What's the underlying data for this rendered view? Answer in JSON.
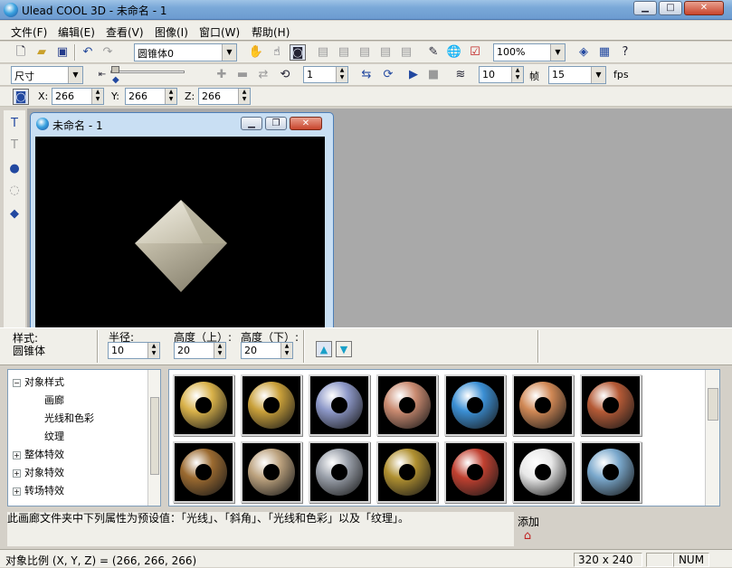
{
  "window": {
    "title": "Ulead COOL 3D - 未命名 - 1"
  },
  "menu": [
    "文件(F)",
    "编辑(E)",
    "查看(V)",
    "图像(I)",
    "窗口(W)",
    "帮助(H)"
  ],
  "toolbar1": {
    "object_select": "圆锥体0",
    "zoom": "100%"
  },
  "toolbar2": {
    "attr_select": "尺寸",
    "frame_value": "1",
    "frames_value": "10",
    "frames_label": "帧",
    "fps_value": "15",
    "fps_label": "fps"
  },
  "toolbar3": {
    "x_label": "X:",
    "x_value": "266",
    "y_label": "Y:",
    "y_value": "266",
    "z_label": "Z:",
    "z_value": "266"
  },
  "doc": {
    "title": "未命名 - 1"
  },
  "props": {
    "style_label": "样式:",
    "style_value": "圆锥体",
    "radius_label": "半径:",
    "radius_value": "10",
    "height_top_label": "高度（上）:",
    "height_top_value": "20",
    "height_bottom_label": "高度（下）:",
    "height_bottom_value": "20"
  },
  "tree": {
    "items": [
      {
        "label": "对象样式",
        "expander": "−"
      },
      {
        "label": "画廊"
      },
      {
        "label": "光线和色彩"
      },
      {
        "label": "纹理"
      },
      {
        "label": "整体特效",
        "expander": "+"
      },
      {
        "label": "对象特效",
        "expander": "+"
      },
      {
        "label": "转场特效",
        "expander": "+"
      }
    ]
  },
  "gallery": {
    "presets": [
      {
        "color": "#d9b24a"
      },
      {
        "color": "#c9a03a"
      },
      {
        "color": "#8d98c8"
      },
      {
        "color": "#c98a70"
      },
      {
        "color": "#3b8fd4"
      },
      {
        "color": "#d08855"
      },
      {
        "color": "#b55a36"
      },
      {
        "color": "#9b6a30"
      },
      {
        "color": "#bca27e"
      },
      {
        "color": "#9aa0aa"
      },
      {
        "color": "#b09030"
      },
      {
        "color": "#c04030"
      },
      {
        "color": "#e8e8e8"
      },
      {
        "color": "#7aa8cc"
      }
    ]
  },
  "description": "此画廊文件夹中下列属性为预设值：「光线」、「斜角」、「光线和色彩」以及「纹理」。",
  "add_label": "添加",
  "status": {
    "scale": "对象比例 (X, Y, Z) = (266, 266, 266)",
    "size": "320 x 240",
    "num": "NUM"
  },
  "colors": {
    "titlebar": "#7aa8d8",
    "workspace": "#a9a9a9",
    "canvas": "#000000"
  }
}
